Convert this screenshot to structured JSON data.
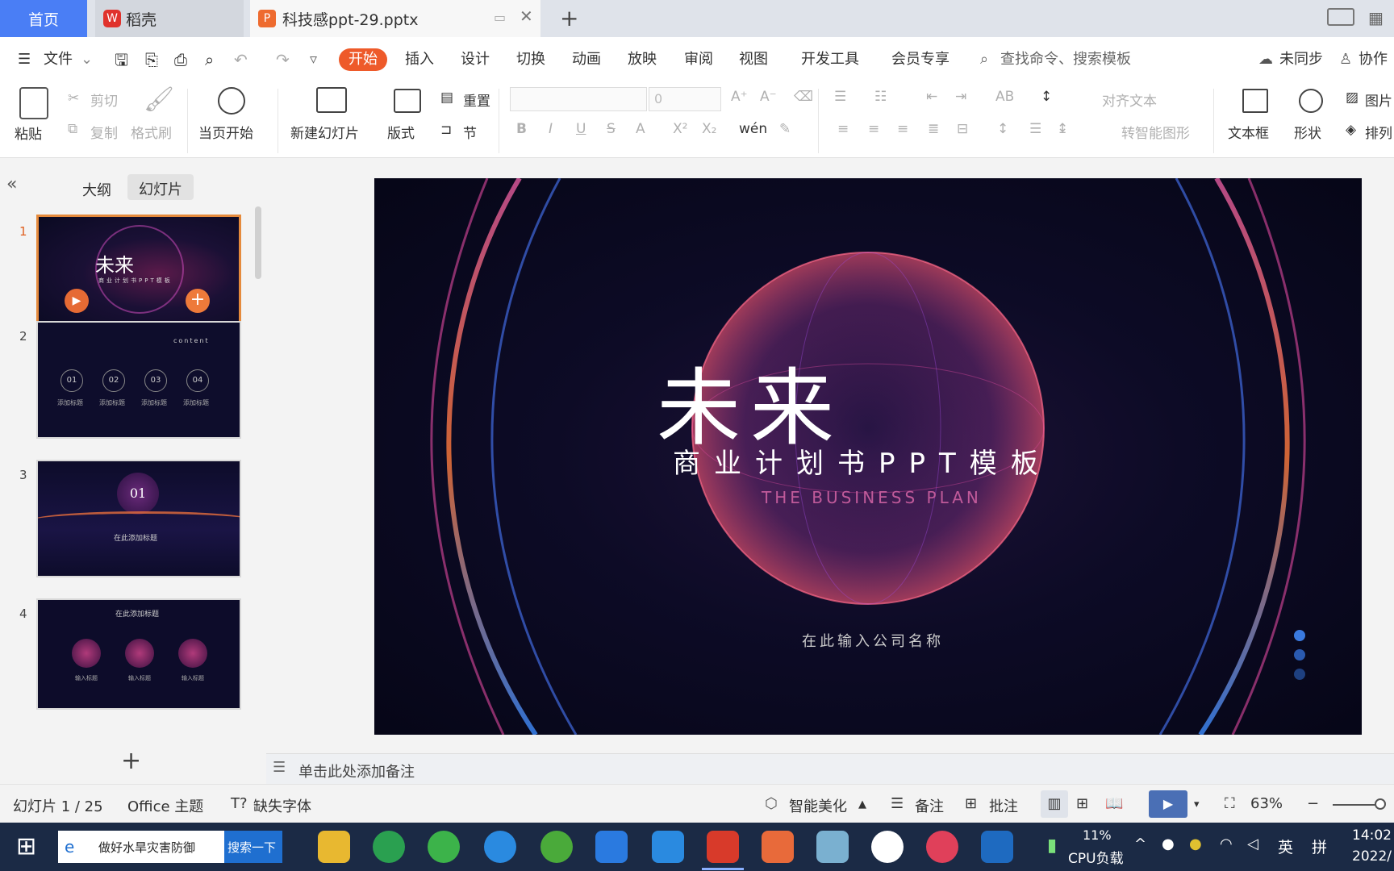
{
  "tabs": {
    "home": "首页",
    "daoke": "稻壳",
    "doc": "科技感ppt-29.pptx",
    "add": "+"
  },
  "menu": {
    "file": "文件",
    "items": [
      "开始",
      "插入",
      "设计",
      "切换",
      "动画",
      "放映",
      "审阅",
      "视图",
      "开发工具",
      "会员专享"
    ],
    "search_placeholder": "查找命令、搜索模板",
    "sync": "未同步",
    "collab": "协作"
  },
  "ribbon": {
    "paste": "粘贴",
    "cut": "剪切",
    "copy": "复制",
    "format_painter": "格式刷",
    "from_current": "当页开始",
    "new_slide": "新建幻灯片",
    "layout": "版式",
    "section": "节",
    "reset": "重置",
    "font_size": "0",
    "align_text": "对齐文本",
    "smart_art": "转智能图形",
    "textbox": "文本框",
    "shape": "形状",
    "picture": "图片",
    "arrange": "排列"
  },
  "leftpane": {
    "outline": "大纲",
    "slides": "幻灯片",
    "numbers": [
      "1",
      "2",
      "3",
      "4"
    ]
  },
  "thumbs": {
    "t1_title": "未来",
    "t1_sub": "商业计划书PPT模板",
    "t2_content": "content",
    "t2_nums": [
      "01",
      "02",
      "03",
      "04"
    ],
    "t2_label": "添加标题",
    "t3_num": "01",
    "t3_title": "在此添加标题",
    "t4_title": "在此添加标题",
    "t4_label": "输入标题"
  },
  "slide": {
    "title": "未来",
    "subtitle": "商业计划书PPT模板",
    "english": "THE BUSINESS PLAN",
    "company": "在此输入公司名称"
  },
  "notes": "单击此处添加备注",
  "status": {
    "slide_count": "幻灯片 1 / 25",
    "theme": "Office 主题",
    "missing_font": "缺失字体",
    "beautify": "智能美化",
    "notes": "备注",
    "comment": "批注",
    "zoom": "63%"
  },
  "taskbar": {
    "search_text": "做好水旱灾害防御",
    "search_btn": "搜索一下",
    "cpu_pct": "11%",
    "cpu_label": "CPU负载",
    "ime": "英",
    "ime2": "拼",
    "time": "14:02",
    "date": "2022/"
  },
  "colors": {
    "accent": "#4a7ef5",
    "start_btn": "#ee5a2a",
    "slide_bg": "#0d0b26"
  }
}
